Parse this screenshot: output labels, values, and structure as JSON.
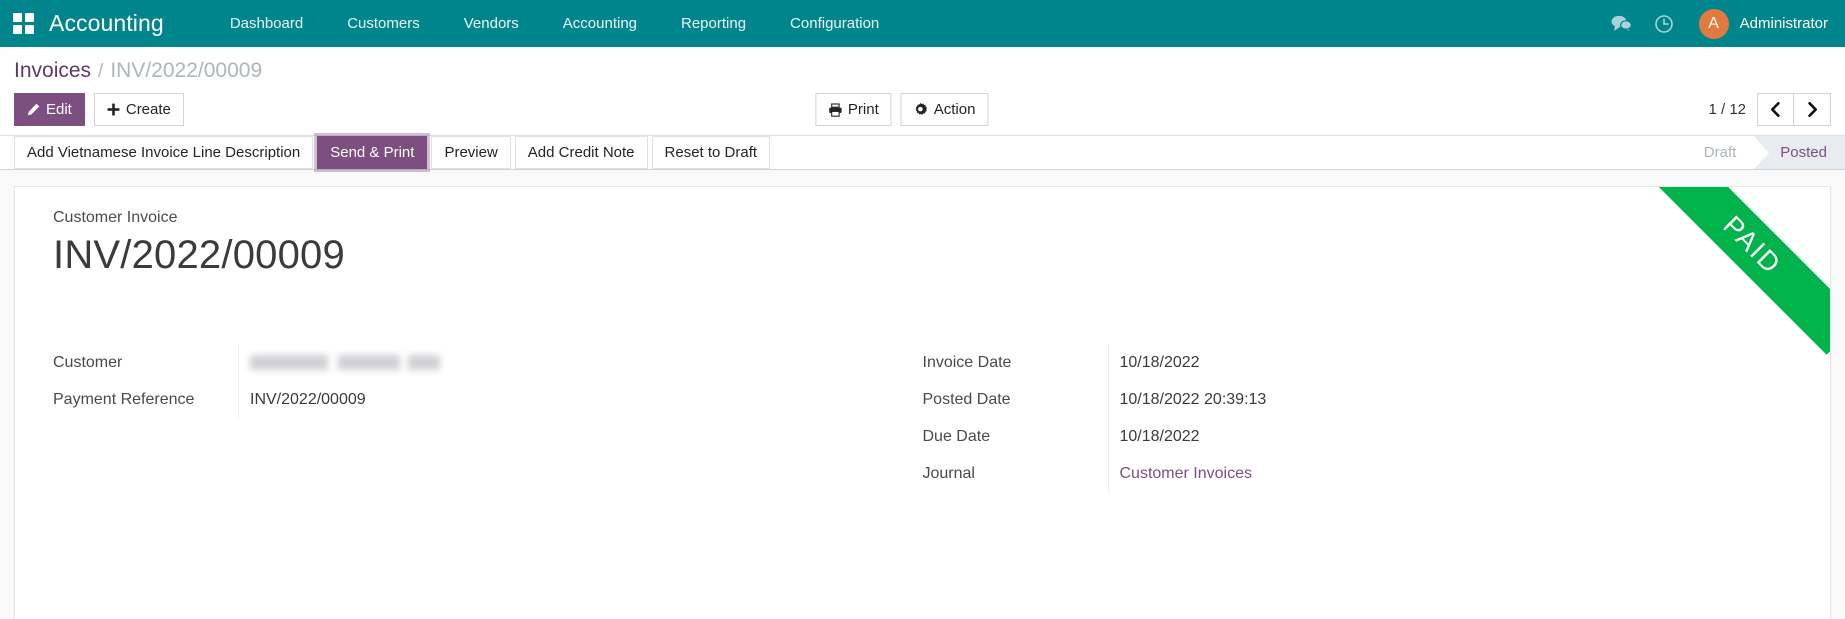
{
  "navbar": {
    "apps_icon": "apps-grid-icon",
    "brand": "Accounting",
    "menu": [
      {
        "label": "Dashboard"
      },
      {
        "label": "Customers"
      },
      {
        "label": "Vendors"
      },
      {
        "label": "Accounting"
      },
      {
        "label": "Reporting"
      },
      {
        "label": "Configuration"
      }
    ],
    "messages_icon": "chat-bubbles-icon",
    "activities_icon": "clock-icon",
    "avatar_initial": "A",
    "user_name": "Administrator",
    "bg_color": "#00858c",
    "avatar_color": "#e27a3f"
  },
  "breadcrumb": {
    "root": "Invoices",
    "separator": "/",
    "current": "INV/2022/00009"
  },
  "controls": {
    "edit_label": "Edit",
    "create_label": "Create",
    "print_label": "Print",
    "action_label": "Action",
    "edit_icon": "pencil-icon",
    "create_icon": "plus-icon",
    "print_icon": "printer-icon",
    "action_icon": "gear-icon",
    "pager_text": "1 / 12",
    "pager_prev_icon": "chevron-left-icon",
    "pager_next_icon": "chevron-right-icon",
    "primary_color": "#7d4e80"
  },
  "statusbar": {
    "buttons": [
      {
        "label": "Add Vietnamese Invoice Line Description",
        "highlighted": false
      },
      {
        "label": "Send & Print",
        "highlighted": true
      },
      {
        "label": "Preview",
        "highlighted": false
      },
      {
        "label": "Add Credit Note",
        "highlighted": false
      },
      {
        "label": "Reset to Draft",
        "highlighted": false
      }
    ],
    "states": [
      {
        "label": "Draft",
        "active": false
      },
      {
        "label": "Posted",
        "active": true
      }
    ]
  },
  "sheet": {
    "ribbon": "PAID",
    "ribbon_color": "#00b34a",
    "subtitle": "Customer Invoice",
    "title": "INV/2022/00009",
    "left_fields": [
      {
        "label": "Customer",
        "value": "",
        "blurred": true
      },
      {
        "label": "Payment Reference",
        "value": "INV/2022/00009",
        "blurred": false
      }
    ],
    "right_fields": [
      {
        "label": "Invoice Date",
        "value": "10/18/2022",
        "link": false
      },
      {
        "label": "Posted Date",
        "value": "10/18/2022 20:39:13",
        "link": false
      },
      {
        "label": "Due Date",
        "value": "10/18/2022",
        "link": false
      },
      {
        "label": "Journal",
        "value": "Customer Invoices",
        "link": true
      }
    ]
  }
}
